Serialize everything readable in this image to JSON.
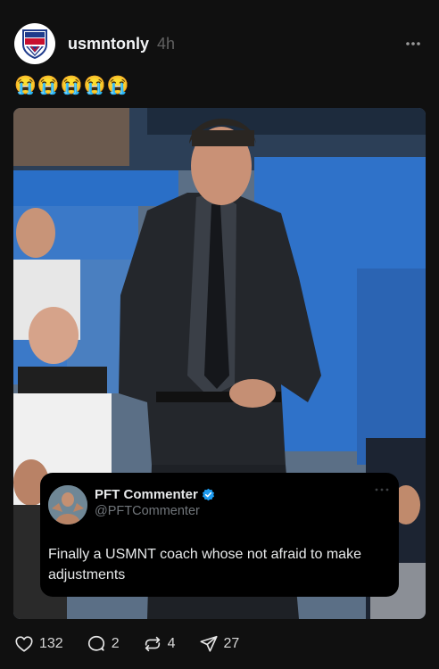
{
  "post": {
    "username": "usmntonly",
    "timestamp": "4h",
    "avatar_text": "USMNT ONLY",
    "more_icon": "ellipsis-icon",
    "text": "😭😭😭😭😭"
  },
  "embedded_tweet": {
    "display_name": "PFT Commenter",
    "handle": "@PFTCommenter",
    "verified_icon": "verified-badge-icon",
    "body": "Finally a USMNT coach whose not afraid to make adjustments"
  },
  "actions": {
    "likes": "132",
    "replies": "2",
    "reposts": "4",
    "shares": "27"
  },
  "colors": {
    "background": "#101010",
    "text_primary": "#f3f5f7",
    "text_secondary": "#616161",
    "verified": "#1d9bf0"
  }
}
